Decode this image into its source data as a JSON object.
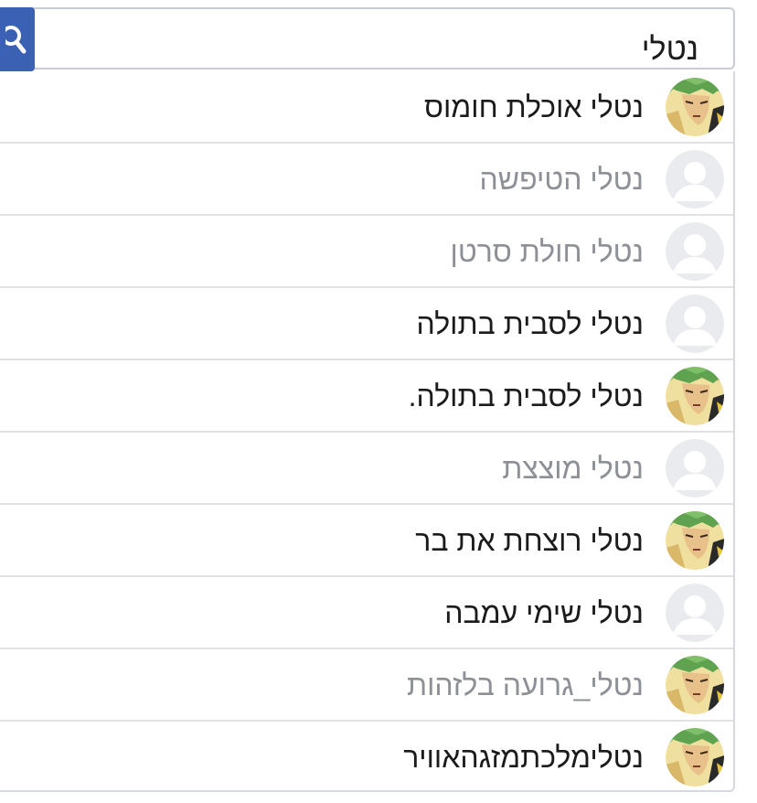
{
  "search": {
    "query": "נטלי"
  },
  "colors": {
    "search_button": "#3b61b4",
    "text_dark": "#1b1b1b",
    "text_muted": "#8d9096",
    "divider": "#dfe1e5"
  },
  "results": [
    {
      "name": "נטלי אוכלת חומוס",
      "avatar": "anime-character-avatar",
      "muted": false
    },
    {
      "name": "נטלי הטיפשה",
      "avatar": "default-avatar",
      "muted": true
    },
    {
      "name": "נטלי חולת סרטן",
      "avatar": "default-avatar",
      "muted": true
    },
    {
      "name": "נטלי לסבית בתולה",
      "avatar": "default-avatar",
      "muted": false
    },
    {
      "name": "נטלי לסבית בתולה.",
      "avatar": "anime-character-avatar",
      "muted": false
    },
    {
      "name": "נטלי מוצצת",
      "avatar": "default-avatar",
      "muted": true
    },
    {
      "name": "נטלי רוצחת את בר",
      "avatar": "anime-character-avatar",
      "muted": false
    },
    {
      "name": "נטלי שימי עמבה",
      "avatar": "default-avatar",
      "muted": false
    },
    {
      "name": "נטלי_גרועה בלזהות",
      "avatar": "anime-character-avatar",
      "muted": true
    },
    {
      "name": "נטלימלכתמזגהאוויר",
      "avatar": "anime-character-avatar",
      "muted": false
    }
  ]
}
